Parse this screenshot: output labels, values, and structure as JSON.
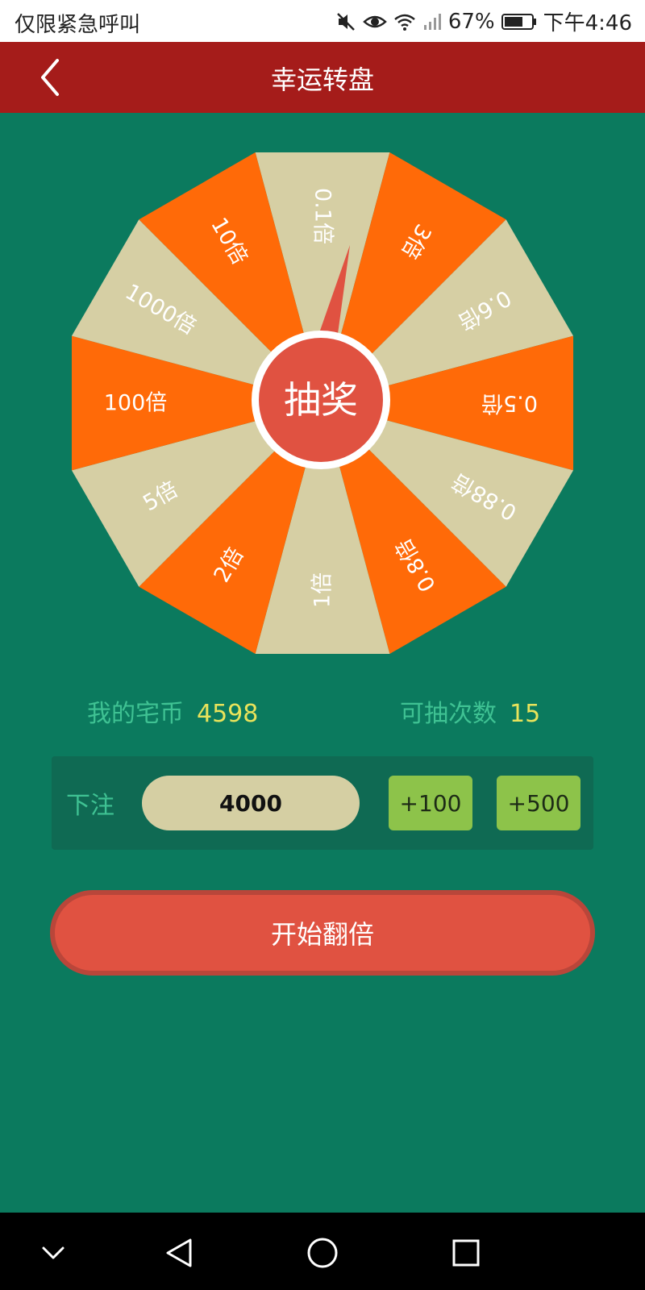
{
  "status_bar": {
    "left_text": "仅限紧急呼叫",
    "battery_percent": "67%",
    "time": "下午4:46",
    "icons": [
      "mute-icon",
      "eye-icon",
      "wifi-icon",
      "signal-icon",
      "battery-icon"
    ]
  },
  "header": {
    "title": "幸运转盘",
    "back_icon": "chevron-left-icon"
  },
  "wheel": {
    "segments": [
      {
        "label": "0.1倍",
        "color": "#d6cfa4"
      },
      {
        "label": "3倍",
        "color": "#ff6a08"
      },
      {
        "label": "0.6倍",
        "color": "#d6cfa4"
      },
      {
        "label": "0.5倍",
        "color": "#ff6a08"
      },
      {
        "label": "0.88倍",
        "color": "#d6cfa4"
      },
      {
        "label": "0.8倍",
        "color": "#ff6a08"
      },
      {
        "label": "1倍",
        "color": "#d6cfa4"
      },
      {
        "label": "2倍",
        "color": "#ff6a08"
      },
      {
        "label": "5倍",
        "color": "#d6cfa4"
      },
      {
        "label": "100倍",
        "color": "#ff6a08"
      },
      {
        "label": "1000倍",
        "color": "#d6cfa4"
      },
      {
        "label": "10倍",
        "color": "#ff6a08"
      }
    ],
    "center_label": "抽奖",
    "center_color": "#e05241"
  },
  "stats": {
    "coins_label": "我的宅币",
    "coins_value": "4598",
    "draws_label": "可抽次数",
    "draws_value": "15"
  },
  "bet": {
    "label": "下注",
    "value": "4000",
    "plus100_label": "+100",
    "plus500_label": "+500"
  },
  "start_button_label": "开始翻倍",
  "colors": {
    "background": "#0b7a5e",
    "header": "#a51c1a",
    "accent_green": "#3fc293",
    "value_yellow": "#e9e35b",
    "orange": "#ff6a08",
    "beige": "#d6cfa4",
    "button_red": "#e05241"
  }
}
